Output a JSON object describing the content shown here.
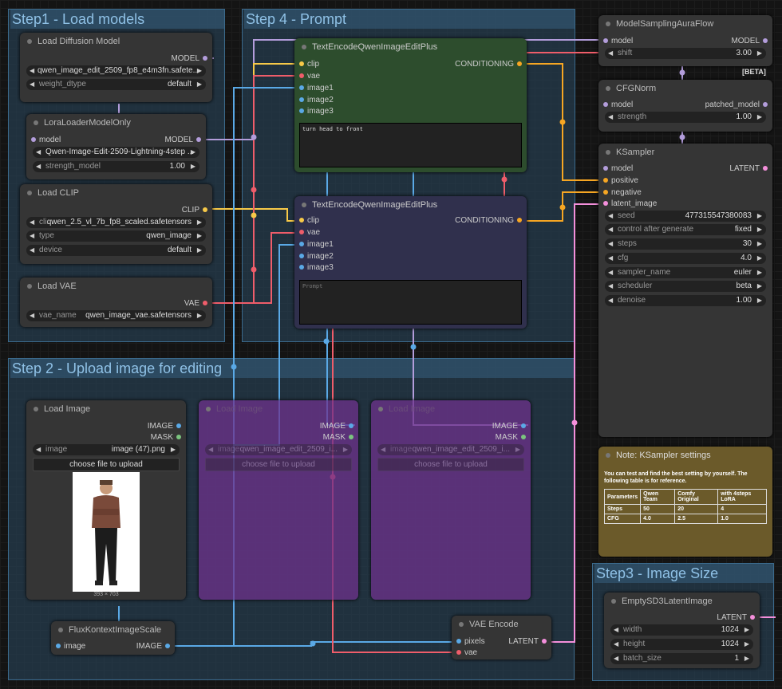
{
  "groups": {
    "step1": "Step1 - Load models",
    "step2": "Step 2 - Upload image for editing",
    "step3": "Step3 - Image Size",
    "step4": "Step 4 - Prompt"
  },
  "load_diffusion": {
    "title": "Load Diffusion Model",
    "out_model": "MODEL",
    "unet_name": "qwen_image_edit_2509_fp8_e4m3fn.safete...",
    "weight_dtype_label": "weight_dtype",
    "weight_dtype": "default"
  },
  "lora": {
    "title": "LoraLoaderModelOnly",
    "in_model": "model",
    "out_model": "MODEL",
    "lora_name": "Qwen-Image-Edit-2509-Lightning-4step ...",
    "strength_label": "strength_model",
    "strength": "1.00"
  },
  "load_clip": {
    "title": "Load CLIP",
    "out_clip": "CLIP",
    "clip_label": "cli...",
    "clip_name": "qwen_2.5_vl_7b_fp8_scaled.safetensors",
    "type_label": "type",
    "type": "qwen_image",
    "device_label": "device",
    "device": "default"
  },
  "load_vae": {
    "title": "Load VAE",
    "out_vae": "VAE",
    "vae_label": "vae_name",
    "vae_name": "qwen_image_vae.safetensors"
  },
  "te_pos": {
    "title": "TextEncodeQwenImageEditPlus",
    "in_clip": "clip",
    "in_vae": "vae",
    "in_image1": "image1",
    "in_image2": "image2",
    "in_image3": "image3",
    "out": "CONDITIONING",
    "prompt": "turn head to front"
  },
  "te_neg": {
    "title": "TextEncodeQwenImageEditPlus",
    "in_clip": "clip",
    "in_vae": "vae",
    "in_image1": "image1",
    "in_image2": "image2",
    "in_image3": "image3",
    "out": "CONDITIONING",
    "placeholder": "Prompt"
  },
  "msaf": {
    "title": "ModelSamplingAuraFlow",
    "in_model": "model",
    "out_model": "MODEL",
    "shift_label": "shift",
    "shift": "3.00",
    "beta": "[BETA]"
  },
  "cfgnorm": {
    "title": "CFGNorm",
    "in_model": "model",
    "out_model": "patched_model",
    "strength_label": "strength",
    "strength": "1.00"
  },
  "ksampler": {
    "title": "KSampler",
    "in_model": "model",
    "in_positive": "positive",
    "in_negative": "negative",
    "in_latent": "latent_image",
    "out_latent": "LATENT",
    "widgets": [
      {
        "label": "seed",
        "value": "477315547380083"
      },
      {
        "label": "control after generate",
        "value": "fixed"
      },
      {
        "label": "steps",
        "value": "30"
      },
      {
        "label": "cfg",
        "value": "4.0"
      },
      {
        "label": "sampler_name",
        "value": "euler"
      },
      {
        "label": "scheduler",
        "value": "beta"
      },
      {
        "label": "denoise",
        "value": "1.00"
      }
    ]
  },
  "note": {
    "title": "Note: KSampler settings",
    "text": "You can test and find the best setting by yourself. The following table is for reference.",
    "table": [
      [
        "Parameters",
        "Qwen Team",
        "Comfy Original",
        "with 4steps LoRA"
      ],
      [
        "Steps",
        "50",
        "20",
        "4"
      ],
      [
        "CFG",
        "4.0",
        "2.5",
        "1.0"
      ]
    ]
  },
  "load_image": {
    "title": "Load Image",
    "out_image": "IMAGE",
    "out_mask": "MASK",
    "image_label": "image",
    "image": "image (47).png",
    "upload": "choose file to upload",
    "dims": "393 × 703"
  },
  "load_image2": {
    "title": "Load Image",
    "out_image": "IMAGE",
    "out_mask": "MASK",
    "image_label": "image",
    "image": "qwen_image_edit_2509_i...",
    "upload": "choose file to upload"
  },
  "load_image3": {
    "title": "Load Image",
    "out_image": "IMAGE",
    "out_mask": "MASK",
    "image_label": "image",
    "image": "qwen_image_edit_2509_i...",
    "upload": "choose file to upload"
  },
  "flux_scale": {
    "title": "FluxKontextImageScale",
    "in_image": "image",
    "out_image": "IMAGE"
  },
  "vae_encode": {
    "title": "VAE Encode",
    "in_pixels": "pixels",
    "in_vae": "vae",
    "out_latent": "LATENT"
  },
  "empty_latent": {
    "title": "EmptySD3LatentImage",
    "out_latent": "LATENT",
    "widgets": [
      {
        "label": "width",
        "value": "1024"
      },
      {
        "label": "height",
        "value": "1024"
      },
      {
        "label": "batch_size",
        "value": "1"
      }
    ]
  }
}
